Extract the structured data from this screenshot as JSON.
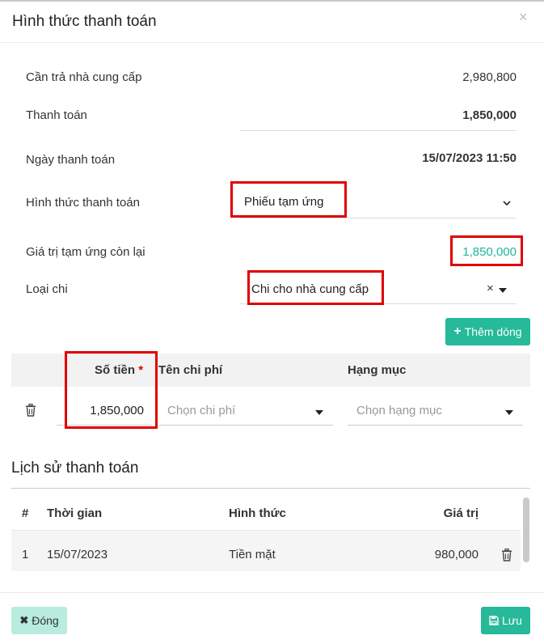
{
  "dialog": {
    "title": "Hình thức thanh toán",
    "close_glyph": "×"
  },
  "form": {
    "can_tra": {
      "label": "Cần trả nhà cung cấp",
      "value": "2,980,800"
    },
    "thanh_toan": {
      "label": "Thanh toán",
      "value": "1,850,000"
    },
    "ngay": {
      "label": "Ngày thanh toán",
      "value": "15/07/2023 11:50"
    },
    "hinh_thuc": {
      "label": "Hình thức thanh toán",
      "value": "Phiếu tạm ứng"
    },
    "gia_tri_tam_ung": {
      "label": "Giá trị tạm ứng còn lại",
      "value": "1,850,000"
    },
    "loai_chi": {
      "label": "Loại chi",
      "value": "Chi cho nhà cung cấp",
      "clear_glyph": "×"
    }
  },
  "add_button": {
    "icon": "plus-icon",
    "label": "Thêm dòng"
  },
  "expense_table": {
    "headers": {
      "so_tien": "Số tiền",
      "required_mark": "*",
      "ten_chi_phi": "Tên chi phí",
      "hang_muc": "Hạng mục"
    },
    "row": {
      "delete_icon": "trash-icon",
      "amount": "1,850,000",
      "chi_phi_placeholder": "Chọn chi phí",
      "hang_muc_placeholder": "Chọn hạng mục"
    }
  },
  "history": {
    "title": "Lịch sử thanh toán",
    "headers": {
      "num": "#",
      "time": "Thời gian",
      "method": "Hình thức",
      "value": "Giá trị"
    },
    "rows": [
      {
        "num": "1",
        "time": "15/07/2023",
        "method": "Tiền mặt",
        "value": "980,000",
        "delete_icon": "trash-icon"
      }
    ]
  },
  "footer": {
    "close_icon": "x-icon",
    "close_label": "Đóng",
    "save_icon": "floppy-icon",
    "save_label": "Lưu"
  },
  "colors": {
    "accent": "#26b99a",
    "highlight_value": "#1fb5a0",
    "annotation_red": "#e00000",
    "close_button_bg": "#b8ecde"
  }
}
